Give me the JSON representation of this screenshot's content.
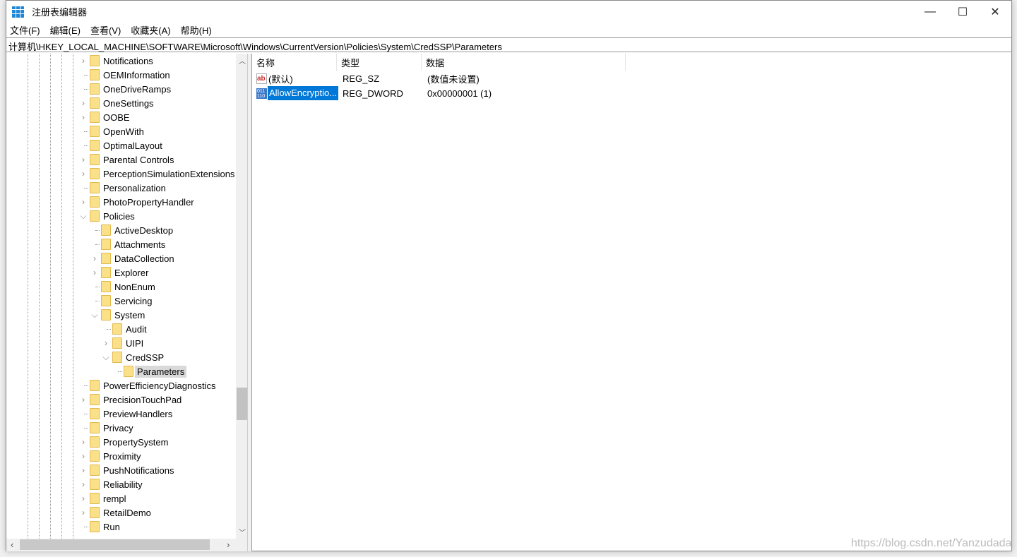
{
  "window": {
    "title": "注册表编辑器",
    "minimize": "—",
    "maximize": "☐",
    "close": "✕"
  },
  "menu": [
    "文件(F)",
    "编辑(E)",
    "查看(V)",
    "收藏夹(A)",
    "帮助(H)"
  ],
  "address": "计算机\\HKEY_LOCAL_MACHINE\\SOFTWARE\\Microsoft\\Windows\\CurrentVersion\\Policies\\System\\CredSSP\\Parameters",
  "tree": [
    {
      "label": "Notifications",
      "level": 0,
      "exp": "closed"
    },
    {
      "label": "OEMInformation",
      "level": 0,
      "exp": "none"
    },
    {
      "label": "OneDriveRamps",
      "level": 0,
      "exp": "none"
    },
    {
      "label": "OneSettings",
      "level": 0,
      "exp": "closed"
    },
    {
      "label": "OOBE",
      "level": 0,
      "exp": "closed"
    },
    {
      "label": "OpenWith",
      "level": 0,
      "exp": "none"
    },
    {
      "label": "OptimalLayout",
      "level": 0,
      "exp": "none"
    },
    {
      "label": "Parental Controls",
      "level": 0,
      "exp": "closed"
    },
    {
      "label": "PerceptionSimulationExtensions",
      "level": 0,
      "exp": "closed"
    },
    {
      "label": "Personalization",
      "level": 0,
      "exp": "none"
    },
    {
      "label": "PhotoPropertyHandler",
      "level": 0,
      "exp": "closed"
    },
    {
      "label": "Policies",
      "level": 0,
      "exp": "open"
    },
    {
      "label": "ActiveDesktop",
      "level": 1,
      "exp": "none"
    },
    {
      "label": "Attachments",
      "level": 1,
      "exp": "none"
    },
    {
      "label": "DataCollection",
      "level": 1,
      "exp": "closed"
    },
    {
      "label": "Explorer",
      "level": 1,
      "exp": "closed"
    },
    {
      "label": "NonEnum",
      "level": 1,
      "exp": "none"
    },
    {
      "label": "Servicing",
      "level": 1,
      "exp": "none"
    },
    {
      "label": "System",
      "level": 1,
      "exp": "open"
    },
    {
      "label": "Audit",
      "level": 2,
      "exp": "none"
    },
    {
      "label": "UIPI",
      "level": 2,
      "exp": "closed"
    },
    {
      "label": "CredSSP",
      "level": 2,
      "exp": "open"
    },
    {
      "label": "Parameters",
      "level": 3,
      "exp": "none",
      "selected": true
    },
    {
      "label": "PowerEfficiencyDiagnostics",
      "level": 0,
      "exp": "none"
    },
    {
      "label": "PrecisionTouchPad",
      "level": 0,
      "exp": "closed"
    },
    {
      "label": "PreviewHandlers",
      "level": 0,
      "exp": "none"
    },
    {
      "label": "Privacy",
      "level": 0,
      "exp": "none"
    },
    {
      "label": "PropertySystem",
      "level": 0,
      "exp": "closed"
    },
    {
      "label": "Proximity",
      "level": 0,
      "exp": "closed"
    },
    {
      "label": "PushNotifications",
      "level": 0,
      "exp": "closed"
    },
    {
      "label": "Reliability",
      "level": 0,
      "exp": "closed"
    },
    {
      "label": "rempl",
      "level": 0,
      "exp": "closed"
    },
    {
      "label": "RetailDemo",
      "level": 0,
      "exp": "closed"
    },
    {
      "label": "Run",
      "level": 0,
      "exp": "none"
    }
  ],
  "columns": [
    "名称",
    "类型",
    "数据"
  ],
  "values": [
    {
      "icon": "ab",
      "name": "(默认)",
      "type": "REG_SZ",
      "data": "(数值未设置)"
    },
    {
      "icon": "dword",
      "name": "AllowEncryptio...",
      "type": "REG_DWORD",
      "data": "0x00000001 (1)",
      "selected": true
    }
  ],
  "watermark": "https://blog.csdn.net/Yanzudada",
  "colors": {
    "selection": "#0078d7",
    "folder": "#fbe08a"
  }
}
